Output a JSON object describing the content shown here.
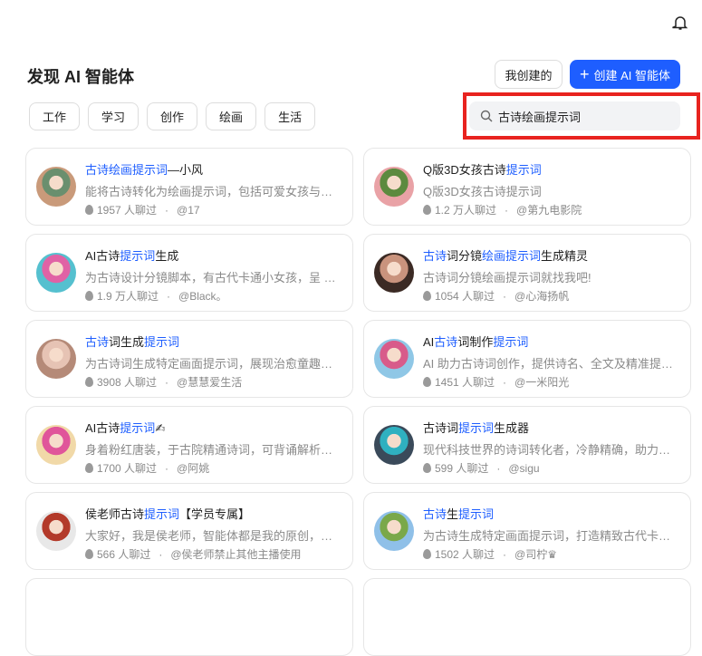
{
  "header": {
    "title": "发现 AI 智能体",
    "my_created": "我创建的",
    "create_label": "创建 AI 智能体"
  },
  "tabs": [
    "工作",
    "学习",
    "创作",
    "绘画",
    "生活"
  ],
  "search": {
    "value": "古诗绘画提示词"
  },
  "cards": [
    {
      "title": [
        {
          "t": "古诗绘画提示词",
          "h": true
        },
        {
          "t": "—小风",
          "h": false
        }
      ],
      "desc": "能将古诗转化为绘画提示词，包括可爱女孩与古...",
      "count": "1957 人聊过",
      "author": "@17",
      "colors": [
        "#c99a7a",
        "#6a8f6e"
      ]
    },
    {
      "title": [
        {
          "t": "Q版3D女孩古诗",
          "h": false
        },
        {
          "t": "提示词",
          "h": true
        }
      ],
      "desc": "Q版3D女孩古诗提示词",
      "count": "1.2 万人聊过",
      "author": "@第九电影院",
      "colors": [
        "#e9a2a6",
        "#5c8a3f"
      ]
    },
    {
      "title": [
        {
          "t": "AI古诗",
          "h": false
        },
        {
          "t": "提示词",
          "h": true
        },
        {
          "t": "生成",
          "h": false
        }
      ],
      "desc": "为古诗设计分镜脚本，有古代卡通小女孩，呈 3D...",
      "count": "1.9 万人聊过",
      "author": "@Black。",
      "colors": [
        "#55c0cf",
        "#e062a5"
      ]
    },
    {
      "title": [
        {
          "t": "古诗",
          "h": true
        },
        {
          "t": "词分镜",
          "h": false
        },
        {
          "t": "绘画提示词",
          "h": true
        },
        {
          "t": "生成精灵",
          "h": false
        }
      ],
      "desc": "古诗词分镜绘画提示词就找我吧!",
      "count": "1054 人聊过",
      "author": "@心海扬帆",
      "colors": [
        "#3b2a24",
        "#c9937d"
      ]
    },
    {
      "title": [
        {
          "t": "古诗",
          "h": true
        },
        {
          "t": "词生成",
          "h": false
        },
        {
          "t": "提示词",
          "h": true
        }
      ],
      "desc": "为古诗词生成特定画面提示词，展现治愈童趣，...",
      "count": "3908 人聊过",
      "author": "@慧慧爱生活",
      "colors": [
        "#b58a78",
        "#e6c3b4"
      ]
    },
    {
      "title": [
        {
          "t": "AI",
          "h": false
        },
        {
          "t": "古诗",
          "h": true
        },
        {
          "t": "词制作",
          "h": false
        },
        {
          "t": "提示词",
          "h": true
        }
      ],
      "desc": "AI 助力古诗词创作，提供诗名、全文及精准提示...",
      "count": "1451 人聊过",
      "author": "@一米阳光",
      "colors": [
        "#8fc7e6",
        "#d85b8a"
      ]
    },
    {
      "title": [
        {
          "t": "AI古诗",
          "h": false
        },
        {
          "t": "提示词",
          "h": true
        },
        {
          "t": "✍",
          "h": false
        }
      ],
      "desc": "身着粉红唐装，于古院精通诗词，可背诵解析及...",
      "count": "1700 人聊过",
      "author": "@阿姚",
      "colors": [
        "#f1d9a8",
        "#e0559a"
      ]
    },
    {
      "title": [
        {
          "t": "古诗词",
          "h": false
        },
        {
          "t": "提示词",
          "h": true
        },
        {
          "t": "生成器",
          "h": false
        }
      ],
      "desc": "现代科技世界的诗词转化者，冷静精确，助力传...",
      "count": "599 人聊过",
      "author": "@sigu",
      "colors": [
        "#3a4a5a",
        "#2fb0c0"
      ]
    },
    {
      "title": [
        {
          "t": "侯老师古诗",
          "h": false
        },
        {
          "t": "提示词",
          "h": true
        },
        {
          "t": "【学员专属】",
          "h": false
        }
      ],
      "desc": "大家好，我是侯老师，智能体都是我的原创，想...",
      "count": "566 人聊过",
      "author": "@侯老师禁止其他主播使用",
      "colors": [
        "#e8e8e8",
        "#b33a2a"
      ]
    },
    {
      "title": [
        {
          "t": "古诗",
          "h": true
        },
        {
          "t": "生",
          "h": false
        },
        {
          "t": "提示词",
          "h": true
        }
      ],
      "desc": "为古诗生成特定画面提示词，打造精致古代卡通...",
      "count": "1502 人聊过",
      "author": "@司柠♛",
      "colors": [
        "#8fc0e8",
        "#7aa84a"
      ]
    }
  ]
}
